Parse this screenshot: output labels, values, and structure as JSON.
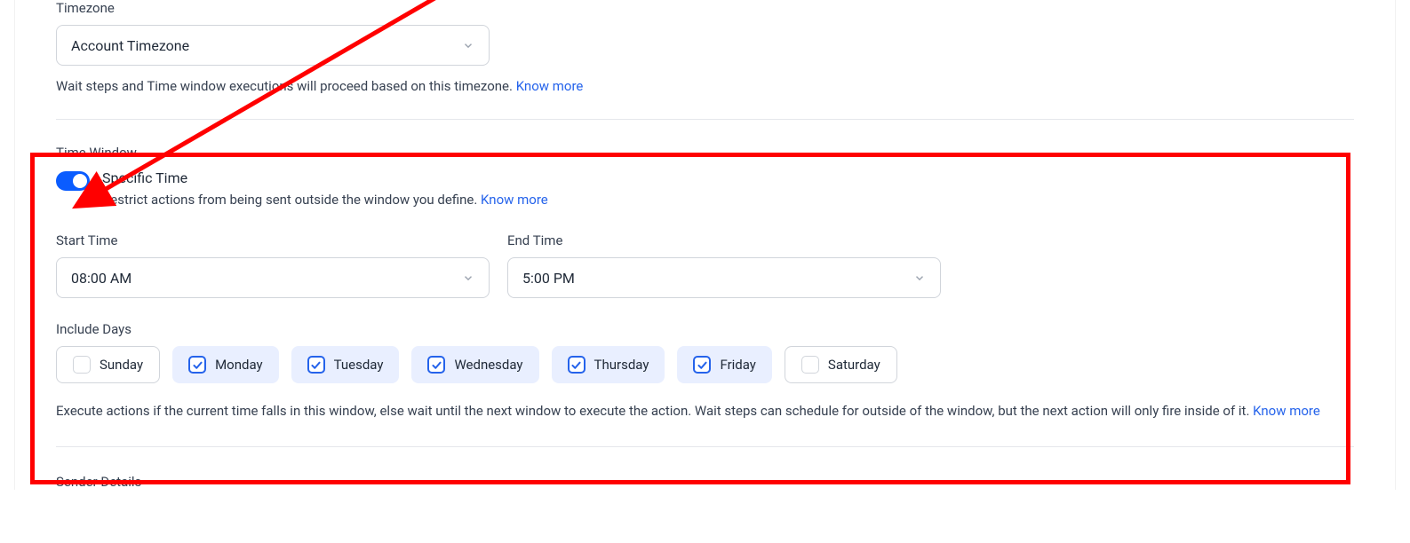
{
  "timezone": {
    "label": "Timezone",
    "selected": "Account Timezone",
    "help": "Wait steps and Time window executions will proceed based on this timezone. ",
    "know_more": "Know more"
  },
  "time_window": {
    "label": "Time Window",
    "toggle_title": "Specific Time",
    "toggle_desc": "Restrict actions from being sent outside the window you define. ",
    "know_more": "Know more",
    "start_label": "Start Time",
    "start_value": "08:00 AM",
    "end_label": "End Time",
    "end_value": "5:00 PM",
    "include_label": "Include Days",
    "days": [
      {
        "name": "Sunday",
        "checked": false
      },
      {
        "name": "Monday",
        "checked": true
      },
      {
        "name": "Tuesday",
        "checked": true
      },
      {
        "name": "Wednesday",
        "checked": true
      },
      {
        "name": "Thursday",
        "checked": true
      },
      {
        "name": "Friday",
        "checked": true
      },
      {
        "name": "Saturday",
        "checked": false
      }
    ],
    "exec_help": "Execute actions if the current time falls in this window, else wait until the next window to execute the action. Wait steps can schedule for outside of the window, but the next action will only fire inside of it. ",
    "exec_know_more": "Know more"
  },
  "sender": {
    "label": "Sender Details"
  }
}
